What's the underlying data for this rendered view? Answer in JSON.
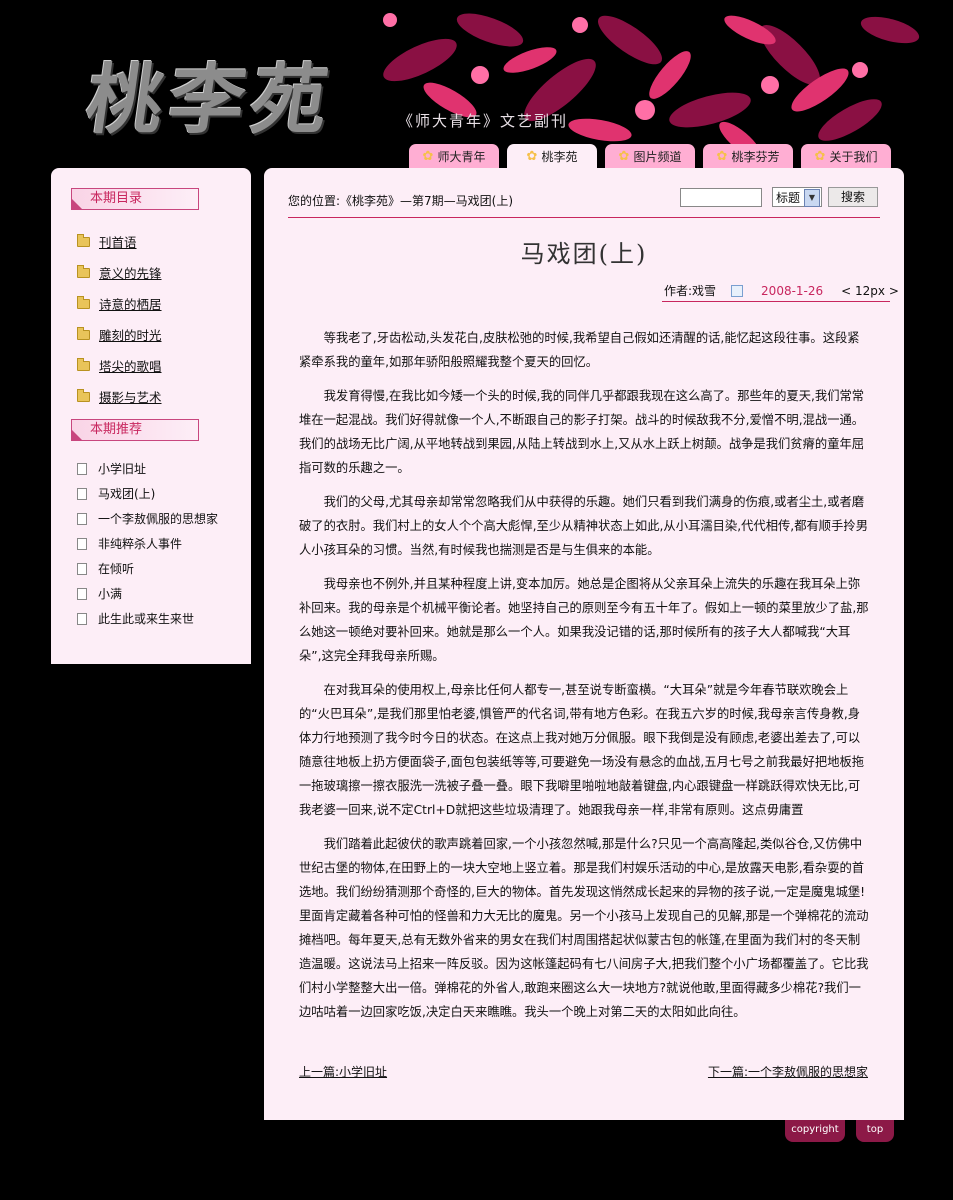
{
  "header": {
    "logo": "桃李苑",
    "tagline": "《师大青年》文艺副刊"
  },
  "tabs": [
    {
      "label": "师大青年",
      "active": false
    },
    {
      "label": "桃李苑",
      "active": true
    },
    {
      "label": "图片频道",
      "active": false
    },
    {
      "label": "桃李芬芳",
      "active": false
    },
    {
      "label": "关于我们",
      "active": false
    }
  ],
  "sidebar": {
    "catalog_title": "本期目录",
    "catalog": [
      "刊首语",
      "意义的先锋",
      "诗意的栖居",
      "雕刻的时光",
      "塔尖的歌唱",
      "摄影与艺术"
    ],
    "recommend_title": "本期推荐",
    "recommend": [
      "小学旧址",
      "马戏团(上)",
      "一个李敖佩服的思想家",
      "非纯粹杀人事件",
      "在倾听",
      "小满",
      "此生此或来生来世"
    ]
  },
  "main": {
    "location": "您的位置:《桃李苑》—第7期—马戏团(上)",
    "search_value": "",
    "search_select": "标题",
    "search_button": "搜索",
    "title": "马戏团(上)",
    "author": "作者:戏雪",
    "date": "2008-1-26",
    "font_size": "< 12px >",
    "paragraphs": [
      "等我老了,牙齿松动,头发花白,皮肤松弛的时候,我希望自己假如还清醒的话,能忆起这段往事。这段紧紧牵系我的童年,如那年骄阳般照耀我整个夏天的回忆。",
      "我发育得慢,在我比如今矮一个头的时候,我的同伴几乎都跟我现在这么高了。那些年的夏天,我们常常堆在一起混战。我们好得就像一个人,不断跟自己的影子打架。战斗的时候敌我不分,爱憎不明,混战一通。我们的战场无比广阔,从平地转战到果园,从陆上转战到水上,又从水上跃上树颠。战争是我们贫瘠的童年屈指可数的乐趣之一。",
      "我们的父母,尤其母亲却常常忽略我们从中获得的乐趣。她们只看到我们满身的伤痕,或者尘土,或者磨破了的衣肘。我们村上的女人个个高大彪悍,至少从精神状态上如此,从小耳濡目染,代代相传,都有顺手拎男人小孩耳朵的习惯。当然,有时候我也揣测是否是与生俱来的本能。",
      "我母亲也不例外,并且某种程度上讲,变本加厉。她总是企图将从父亲耳朵上流失的乐趣在我耳朵上弥补回来。我的母亲是个机械平衡论者。她坚持自己的原则至今有五十年了。假如上一顿的菜里放少了盐,那么她这一顿绝对要补回来。她就是那么一个人。如果我没记错的话,那时候所有的孩子大人都喊我“大耳朵”,这完全拜我母亲所赐。",
      "在对我耳朵的使用权上,母亲比任何人都专一,甚至说专断蛮横。“大耳朵”就是今年春节联欢晚会上的“火巴耳朵”,是我们那里怕老婆,惧管严的代名词,带有地方色彩。在我五六岁的时候,我母亲言传身教,身体力行地预测了我今时今日的状态。在这点上我对她万分佩服。眼下我倒是没有顾虑,老婆出差去了,可以随意往地板上扔方便面袋子,面包包装纸等等,可要避免一场没有悬念的血战,五月七号之前我最好把地板拖一拖玻璃擦一擦衣服洗一洗被子叠一叠。眼下我噼里啪啦地敲着键盘,内心跟键盘一样跳跃得欢快无比,可我老婆一回来,说不定Ctrl+D就把这些垃圾清理了。她跟我母亲一样,非常有原则。这点毋庸置",
      "我们踏着此起彼伏的歌声跳着回家,一个小孩忽然喊,那是什么?只见一个高高隆起,类似谷仓,又仿佛中世纪古堡的物体,在田野上的一块大空地上竖立着。那是我们村娱乐活动的中心,是放露天电影,看杂耍的首选地。我们纷纷猜测那个奇怪的,巨大的物体。首先发现这悄然成长起来的异物的孩子说,一定是魔鬼城堡!里面肯定藏着各种可怕的怪兽和力大无比的魔鬼。另一个小孩马上发现自己的见解,那是一个弹棉花的流动摊档吧。每年夏天,总有无数外省来的男女在我们村周围搭起状似蒙古包的帐篷,在里面为我们村的冬天制造温暖。这说法马上招来一阵反驳。因为这帐篷起码有七八间房子大,把我们整个小广场都覆盖了。它比我们村小学整整大出一倍。弹棉花的外省人,敢跑来圈这么大一块地方?就说他敢,里面得藏多少棉花?我们一边咕咕着一边回家吃饭,决定白天来瞧瞧。我头一个晚上对第二天的太阳如此向往。"
    ],
    "prev": "上一篇:小学旧址",
    "next": "下一篇:一个李敖佩服的思想家"
  },
  "footer": {
    "copyright": "copyright",
    "top": "top"
  },
  "colors": {
    "page_bg": "#000000",
    "panel_bg": "#fdeef7",
    "accent": "#c8265e",
    "tab": "#ffaed3"
  }
}
